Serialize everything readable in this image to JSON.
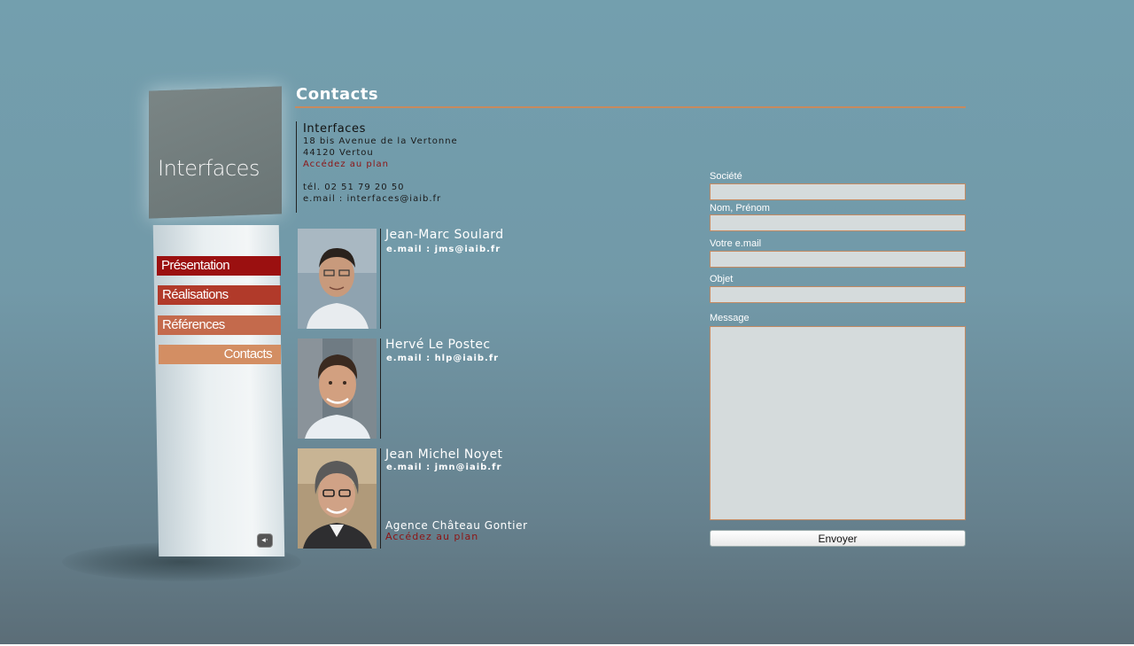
{
  "brand": {
    "logo_text": "Interfaces"
  },
  "nav": {
    "items": [
      {
        "label": "Présentation"
      },
      {
        "label": "Réalisations"
      },
      {
        "label": "Références"
      },
      {
        "label": "Contacts"
      }
    ],
    "back_glyph": "◂·"
  },
  "page": {
    "title": "Contacts"
  },
  "company": {
    "name": "Interfaces",
    "address_line1": "18 bis Avenue de la Vertonne",
    "address_line2": "44120 Vertou",
    "plan_link": "Accédez au plan",
    "phone": "tél. 02 51 79 20 50",
    "email": "e.mail : interfaces@iaib.fr"
  },
  "people": [
    {
      "name": "Jean-Marc Soulard",
      "email": "e.mail : jms@iaib.fr"
    },
    {
      "name": "Hervé Le Postec",
      "email": "e.mail : hlp@iaib.fr"
    },
    {
      "name": "Jean Michel Noyet",
      "email": "e.mail : jmn@iaib.fr"
    }
  ],
  "agency": {
    "name": "Agence Château Gontier",
    "plan_link": "Accédez au plan"
  },
  "form": {
    "fields": [
      {
        "label": "Société",
        "value": ""
      },
      {
        "label": "Nom, Prénom",
        "value": ""
      },
      {
        "label": "Votre e.mail",
        "value": ""
      },
      {
        "label": "Objet",
        "value": ""
      }
    ],
    "message_label": "Message",
    "message_value": "",
    "submit_label": "Envoyer"
  },
  "colors": {
    "background": "#7299a8",
    "accent_rule": "#c78a5e",
    "menu_presentation": "#9b1010",
    "menu_realisations": "#b13a2a",
    "menu_references": "#c46a4c",
    "menu_contacts": "#d38e63",
    "link_red": "#8c1414"
  }
}
